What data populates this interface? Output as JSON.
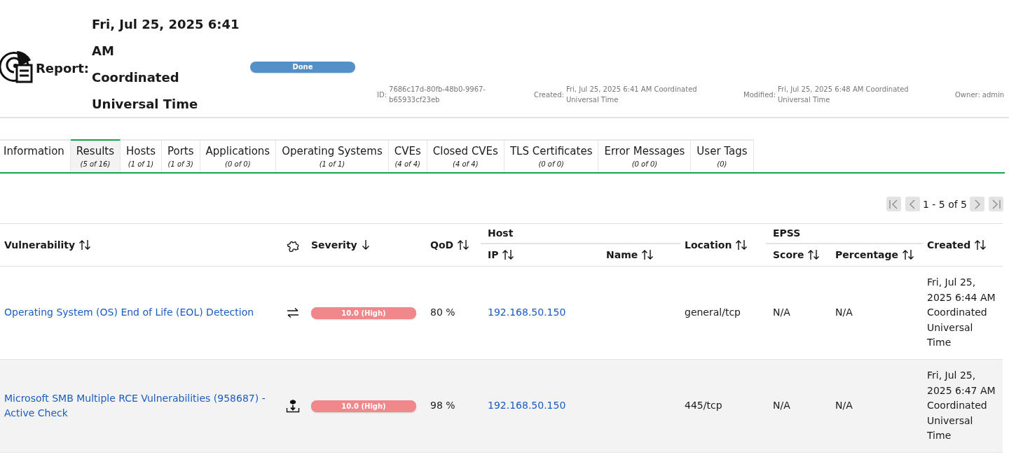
{
  "header": {
    "label": "Report:",
    "title": "Fri, Jul 25, 2025 6:41 AM",
    "timezone": "Coordinated Universal Time",
    "status": {
      "text": "Done",
      "level": 1
    },
    "meta": [
      {
        "label": "ID:",
        "value": "7686c17d-80fb-48b0-9967-b65933cf23eb"
      },
      {
        "label": "Created:",
        "value": "Fri, Jul 25, 2025 6:41 AM Coordinated Universal Time"
      },
      {
        "label": "Modified:",
        "value": "Fri, Jul 25, 2025 6:48 AM Coordinated Universal Time"
      },
      {
        "label": "Owner:",
        "value": "admin"
      }
    ]
  },
  "tabs": [
    {
      "label": "Information",
      "selected": false
    },
    {
      "label": "Results",
      "count": "(5 of 16)",
      "selected": true
    },
    {
      "label": "Hosts",
      "count": "(1 of 1)",
      "selected": false
    },
    {
      "label": "Ports",
      "count": "(1 of 3)",
      "selected": false
    },
    {
      "label": "Applications",
      "count": "(0 of 0)",
      "selected": false
    },
    {
      "label": "Operating Systems",
      "count": "(1 of 1)",
      "selected": false
    },
    {
      "label": "CVEs",
      "count": "(4 of 4)",
      "selected": false
    },
    {
      "label": "Closed CVEs",
      "count": "(4 of 4)",
      "selected": false
    },
    {
      "label": "TLS Certificates",
      "count": "(0 of 0)",
      "selected": false
    },
    {
      "label": "Error Messages",
      "count": "(0 of 0)",
      "selected": false
    },
    {
      "label": "User Tags",
      "count": "(0)",
      "selected": false
    }
  ],
  "pagination": {
    "text": "1 - 5 of 5",
    "buttons": [
      {
        "kind": "first",
        "disabled": true
      },
      {
        "kind": "prev",
        "disabled": true
      },
      {
        "kind": "next",
        "disabled": true
      },
      {
        "kind": "last",
        "disabled": true
      }
    ]
  },
  "table": {
    "columns": [
      {
        "label": "Vulnerability",
        "kind": "sortable"
      },
      {
        "kind": "solution"
      },
      {
        "label": "Severity",
        "kind": "sorted_desc"
      },
      {
        "label": "QoD",
        "kind": "sortable"
      },
      {
        "group": "Host",
        "kind": "group",
        "children": [
          {
            "label": "IP",
            "kind": "sortable"
          },
          {
            "label": "Name",
            "kind": "sortable"
          }
        ]
      },
      {
        "label": "Location",
        "kind": "sortable"
      },
      {
        "group": "EPSS",
        "kind": "group",
        "children": [
          {
            "label": "Score",
            "kind": "sortable"
          },
          {
            "label": "Percentage",
            "kind": "sortable"
          }
        ]
      },
      {
        "label": "Created",
        "kind": "sortable"
      }
    ],
    "rows": [
      {
        "vulnerability": "Operating System (OS) End of Life (EOL) Detection",
        "kind": "workaround",
        "severity": "10.0 (High)",
        "level": 1,
        "qod": "80 %",
        "ip": "192.168.50.150",
        "location": "general/tcp",
        "epss_score": "N/A",
        "epss_percentage": "N/A",
        "created": "Fri, Jul 25, 2025 6:44 AM Coordinated Universal Time"
      },
      {
        "vulnerability": "Microsoft SMB Multiple RCE Vulnerabilities (958687) - Active Check",
        "kind": "vendorfix",
        "severity": "10.0 (High)",
        "level": 1,
        "qod": "98 %",
        "ip": "192.168.50.150",
        "location": "445/tcp",
        "epss_score": "N/A",
        "epss_percentage": "N/A",
        "created": "Fri, Jul 25, 2025 6:47 AM Coordinated Universal Time"
      }
    ]
  }
}
